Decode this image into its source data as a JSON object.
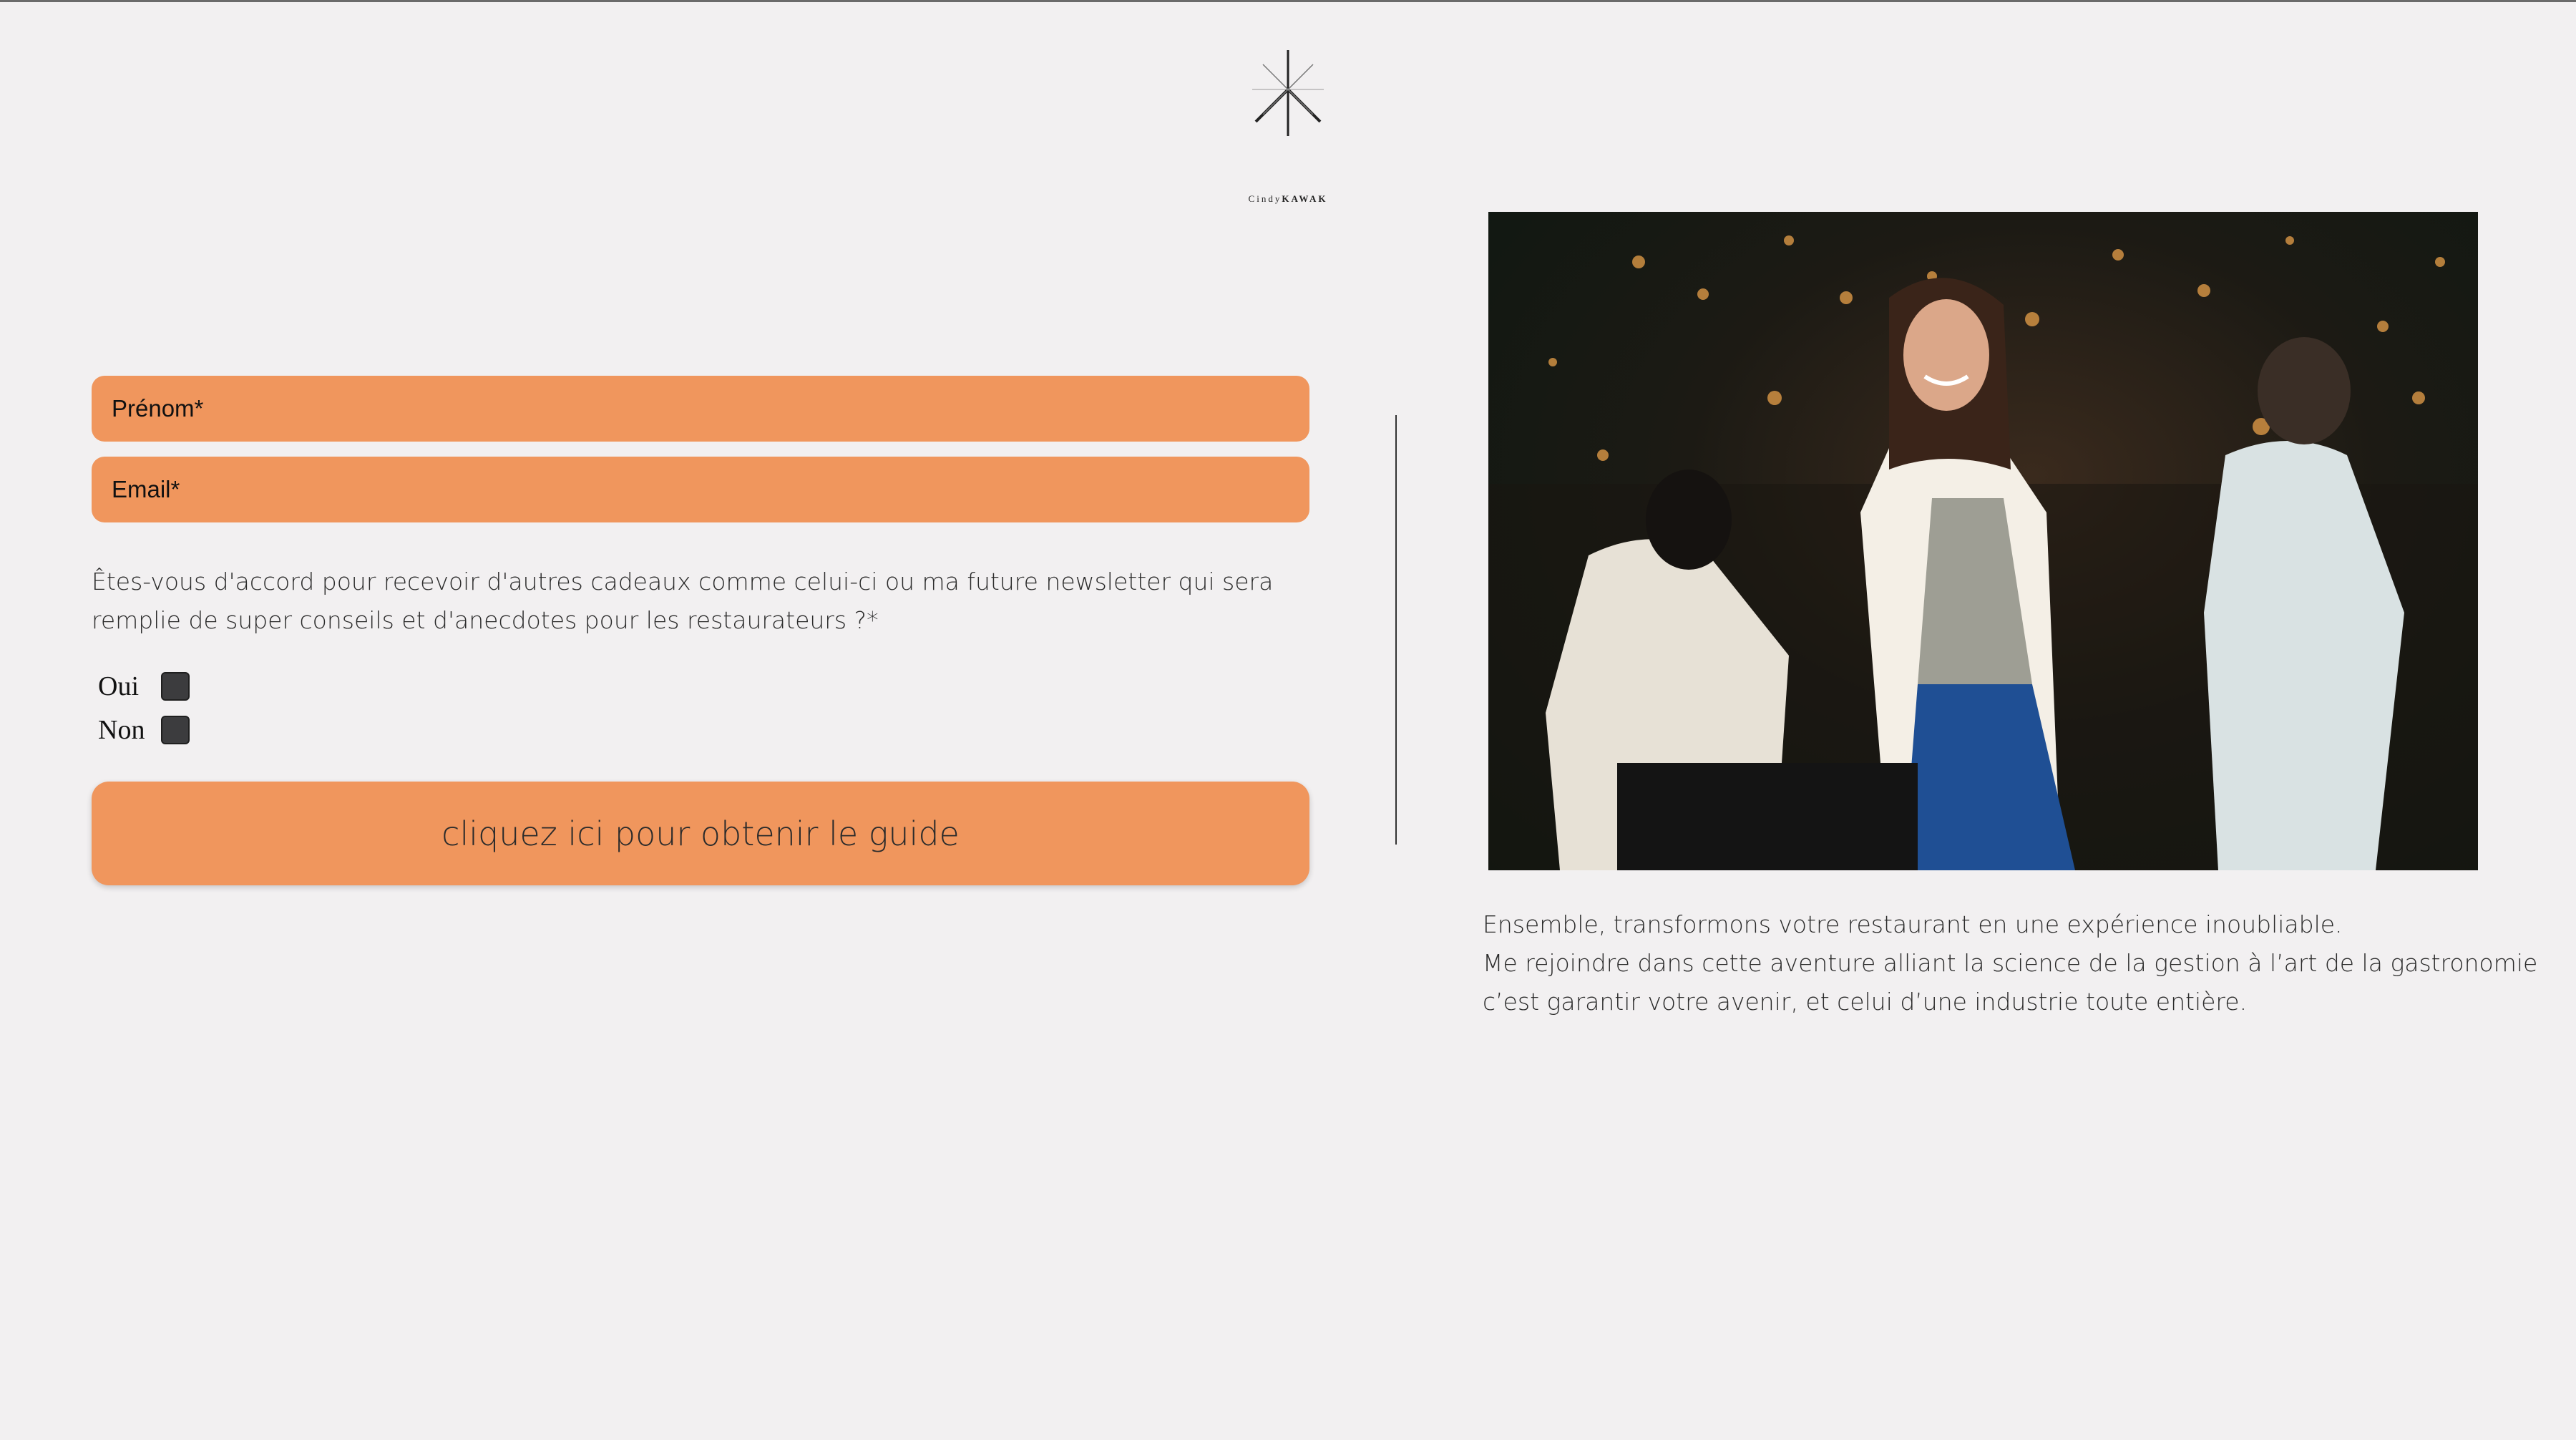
{
  "brand": {
    "name_first": "Cindy",
    "name_last": "KAWAK",
    "logo_icon": "asterisk-star-logo"
  },
  "form": {
    "firstname_placeholder": "Prénom*",
    "email_placeholder": "Email*",
    "question": "Êtes-vous d'accord pour recevoir d'autres cadeaux comme celui-ci ou ma future newsletter qui sera remplie de super conseils et d'anecdotes pour les restaurateurs ?*",
    "options": [
      {
        "label": "Oui",
        "checked": false
      },
      {
        "label": "Non",
        "checked": false
      }
    ],
    "submit_label": "cliquez ici pour obtenir le guide"
  },
  "photo": {
    "subject": "smiling woman in white blazer at restaurant"
  },
  "caption": {
    "line1": "Ensemble, transformons votre restaurant en une expérience inoubliable.",
    "line2": "Me rejoindre dans cette aventure alliant la science de la gestion à l’art de la gastronomie",
    "line3": "c’est garantir votre avenir, et celui d’une industrie toute entière."
  },
  "colors": {
    "background": "#f2f0f1",
    "accent": "#f0965d",
    "text": "#2b2b2b"
  }
}
